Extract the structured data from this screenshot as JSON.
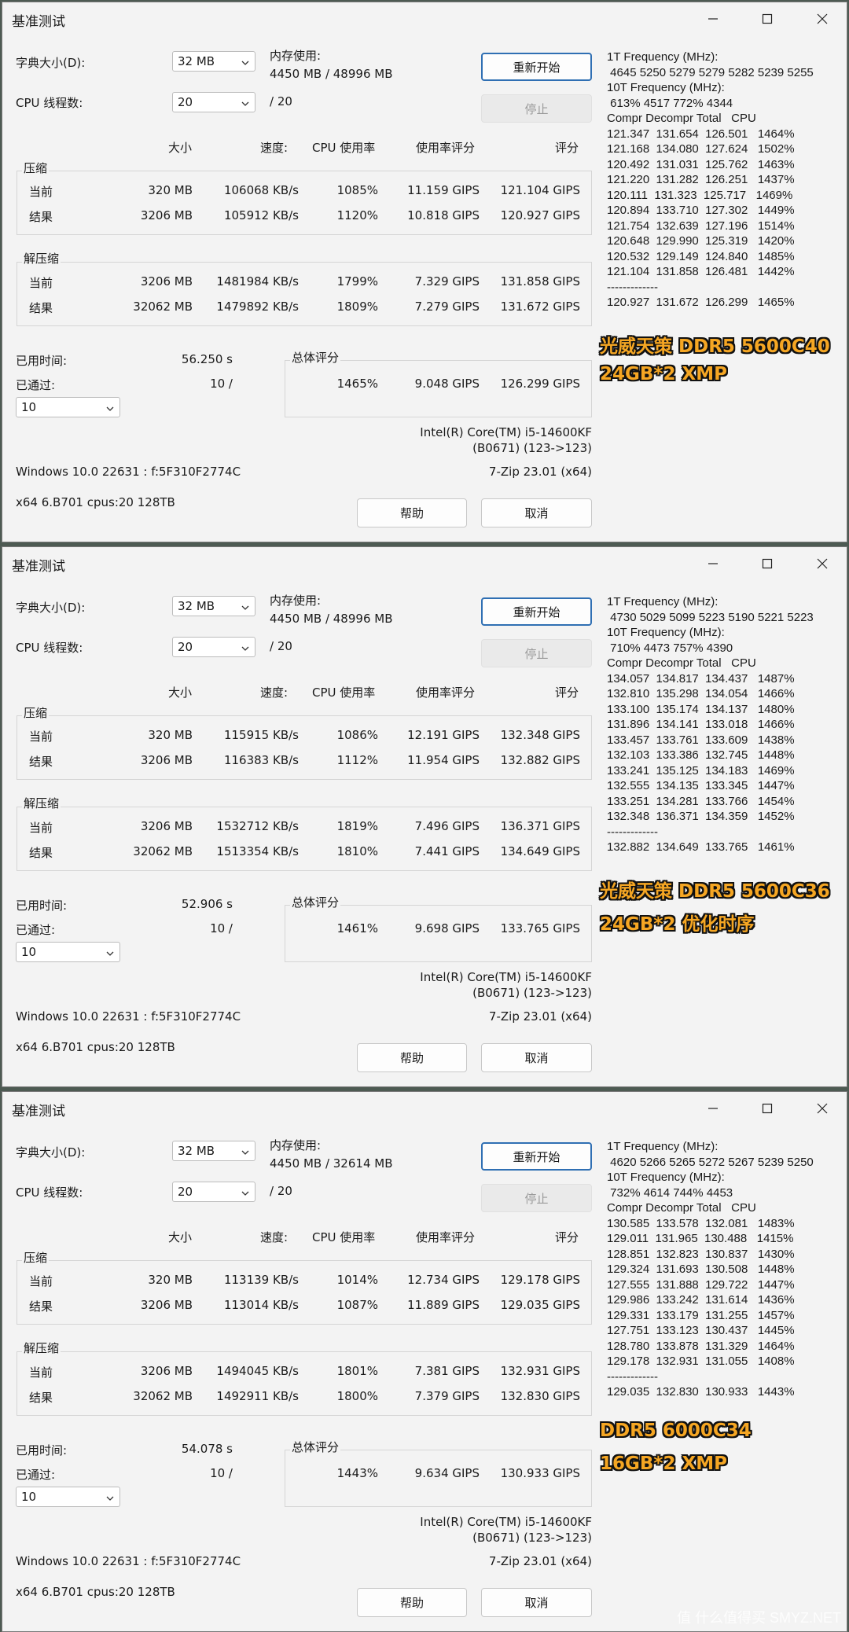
{
  "windows": [
    {
      "title": "基准测试",
      "dict_label": "字典大小(D):",
      "dict_value": "32 MB",
      "mem_label": "内存使用:",
      "mem_value": "4450 MB / 48996 MB",
      "threads_label": "CPU 线程数:",
      "threads_value": "20",
      "threads_total": "/ 20",
      "restart": "重新开始",
      "stop": "停止",
      "headers": {
        "size": "大小",
        "speed": "速度:",
        "cpu": "CPU 使用率",
        "rating_usage": "使用率评分",
        "rating": "评分"
      },
      "compress_label": "压缩",
      "compress": [
        {
          "label": "当前",
          "size": "320 MB",
          "speed": "106068 KB/s",
          "cpu": "1085%",
          "ru": "11.159 GIPS",
          "r": "121.104 GIPS"
        },
        {
          "label": "结果",
          "size": "3206 MB",
          "speed": "105912 KB/s",
          "cpu": "1120%",
          "ru": "10.818 GIPS",
          "r": "120.927 GIPS"
        }
      ],
      "decompress_label": "解压缩",
      "decompress": [
        {
          "label": "当前",
          "size": "3206 MB",
          "speed": "1481984 KB/s",
          "cpu": "1799%",
          "ru": "7.329 GIPS",
          "r": "131.858 GIPS"
        },
        {
          "label": "结果",
          "size": "32062 MB",
          "speed": "1479892 KB/s",
          "cpu": "1809%",
          "ru": "7.279 GIPS",
          "r": "131.672 GIPS"
        }
      ],
      "elapsed_label": "已用时间:",
      "elapsed": "56.250 s",
      "passed_label": "已通过:",
      "passed": "10 /",
      "passes_value": "10",
      "total_label": "总体评分",
      "total": {
        "cpu": "1465%",
        "ru": "9.048 GIPS",
        "r": "126.299 GIPS"
      },
      "cpu_name": "Intel(R) Core(TM) i5-14600KF",
      "cpu_id": "(B0671) (123->123)",
      "os": "Windows 10.0 22631 : f:5F310F2774C",
      "zip": "7-Zip 23.01 (x64)",
      "arch": "x64 6.B701 cpus:20 128TB",
      "help": "帮助",
      "cancel": "取消",
      "side_text": "1T Frequency (MHz):\n 4645 5250 5279 5279 5282 5239 5255\n10T Frequency (MHz):\n 613% 4517 772% 4344\nCompr Decompr Total   CPU\n121.347  131.654  126.501   1464%\n121.168  134.080  127.624   1502%\n120.492  131.031  125.762   1463%\n121.220  131.282  126.251   1437%\n120.111  131.323  125.717   1469%\n120.894  133.710  127.302   1449%\n121.754  132.639  127.196   1514%\n120.648  129.990  125.319   1420%\n120.532  129.149  124.840   1485%\n121.104  131.858  126.481   1442%\n-------------\n120.927  131.672  126.299   1465%",
      "overlay1": "光威天策 DDR5 5600C40",
      "overlay2": "24GB*2  XMP"
    },
    {
      "title": "基准测试",
      "dict_label": "字典大小(D):",
      "dict_value": "32 MB",
      "mem_label": "内存使用:",
      "mem_value": "4450 MB / 48996 MB",
      "threads_label": "CPU 线程数:",
      "threads_value": "20",
      "threads_total": "/ 20",
      "restart": "重新开始",
      "stop": "停止",
      "headers": {
        "size": "大小",
        "speed": "速度:",
        "cpu": "CPU 使用率",
        "rating_usage": "使用率评分",
        "rating": "评分"
      },
      "compress_label": "压缩",
      "compress": [
        {
          "label": "当前",
          "size": "320 MB",
          "speed": "115915 KB/s",
          "cpu": "1086%",
          "ru": "12.191 GIPS",
          "r": "132.348 GIPS"
        },
        {
          "label": "结果",
          "size": "3206 MB",
          "speed": "116383 KB/s",
          "cpu": "1112%",
          "ru": "11.954 GIPS",
          "r": "132.882 GIPS"
        }
      ],
      "decompress_label": "解压缩",
      "decompress": [
        {
          "label": "当前",
          "size": "3206 MB",
          "speed": "1532712 KB/s",
          "cpu": "1819%",
          "ru": "7.496 GIPS",
          "r": "136.371 GIPS"
        },
        {
          "label": "结果",
          "size": "32062 MB",
          "speed": "1513354 KB/s",
          "cpu": "1810%",
          "ru": "7.441 GIPS",
          "r": "134.649 GIPS"
        }
      ],
      "elapsed_label": "已用时间:",
      "elapsed": "52.906 s",
      "passed_label": "已通过:",
      "passed": "10 /",
      "passes_value": "10",
      "total_label": "总体评分",
      "total": {
        "cpu": "1461%",
        "ru": "9.698 GIPS",
        "r": "133.765 GIPS"
      },
      "cpu_name": "Intel(R) Core(TM) i5-14600KF",
      "cpu_id": "(B0671) (123->123)",
      "os": "Windows 10.0 22631 : f:5F310F2774C",
      "zip": "7-Zip 23.01 (x64)",
      "arch": "x64 6.B701 cpus:20 128TB",
      "help": "帮助",
      "cancel": "取消",
      "side_text": "1T Frequency (MHz):\n 4730 5029 5099 5223 5190 5221 5223\n10T Frequency (MHz):\n 710% 4473 757% 4390\nCompr Decompr Total   CPU\n134.057  134.817  134.437   1487%\n132.810  135.298  134.054   1466%\n133.100  135.174  134.137   1480%\n131.896  134.141  133.018   1466%\n133.457  133.761  133.609   1438%\n132.103  133.386  132.745   1448%\n133.241  135.125  134.183   1469%\n132.555  134.135  133.345   1447%\n133.251  134.281  133.766   1454%\n132.348  136.371  134.359   1452%\n-------------\n132.882  134.649  133.765   1461%",
      "overlay1": "光威天策 DDR5 5600C36",
      "overlay2": "24GB*2  优化时序"
    },
    {
      "title": "基准测试",
      "dict_label": "字典大小(D):",
      "dict_value": "32 MB",
      "mem_label": "内存使用:",
      "mem_value": "4450 MB / 32614 MB",
      "threads_label": "CPU 线程数:",
      "threads_value": "20",
      "threads_total": "/ 20",
      "restart": "重新开始",
      "stop": "停止",
      "headers": {
        "size": "大小",
        "speed": "速度:",
        "cpu": "CPU 使用率",
        "rating_usage": "使用率评分",
        "rating": "评分"
      },
      "compress_label": "压缩",
      "compress": [
        {
          "label": "当前",
          "size": "320 MB",
          "speed": "113139 KB/s",
          "cpu": "1014%",
          "ru": "12.734 GIPS",
          "r": "129.178 GIPS"
        },
        {
          "label": "结果",
          "size": "3206 MB",
          "speed": "113014 KB/s",
          "cpu": "1087%",
          "ru": "11.889 GIPS",
          "r": "129.035 GIPS"
        }
      ],
      "decompress_label": "解压缩",
      "decompress": [
        {
          "label": "当前",
          "size": "3206 MB",
          "speed": "1494045 KB/s",
          "cpu": "1801%",
          "ru": "7.381 GIPS",
          "r": "132.931 GIPS"
        },
        {
          "label": "结果",
          "size": "32062 MB",
          "speed": "1492911 KB/s",
          "cpu": "1800%",
          "ru": "7.379 GIPS",
          "r": "132.830 GIPS"
        }
      ],
      "elapsed_label": "已用时间:",
      "elapsed": "54.078 s",
      "passed_label": "已通过:",
      "passed": "10 /",
      "passes_value": "10",
      "total_label": "总体评分",
      "total": {
        "cpu": "1443%",
        "ru": "9.634 GIPS",
        "r": "130.933 GIPS"
      },
      "cpu_name": "Intel(R) Core(TM) i5-14600KF",
      "cpu_id": "(B0671) (123->123)",
      "os": "Windows 10.0 22631 : f:5F310F2774C",
      "zip": "7-Zip 23.01 (x64)",
      "arch": "x64 6.B701 cpus:20 128TB",
      "help": "帮助",
      "cancel": "取消",
      "side_text": "1T Frequency (MHz):\n 4620 5266 5265 5272 5267 5239 5250\n10T Frequency (MHz):\n 732% 4614 744% 4453\nCompr Decompr Total   CPU\n130.585  133.578  132.081   1483%\n129.011  131.965  130.488   1415%\n128.851  132.823  130.837   1430%\n129.324  131.693  130.508   1448%\n127.555  131.888  129.722   1447%\n129.986  133.242  131.614   1436%\n129.331  133.179  131.255   1457%\n127.751  133.123  130.437   1445%\n128.780  133.878  131.329   1464%\n129.178  132.931  131.055   1408%\n-------------\n129.035  132.830  130.933   1443%",
      "overlay1": "DDR5 6000C34",
      "overlay2": "16GB*2  XMP"
    }
  ],
  "watermark": "值 什么值得买 SMYZ.NET"
}
